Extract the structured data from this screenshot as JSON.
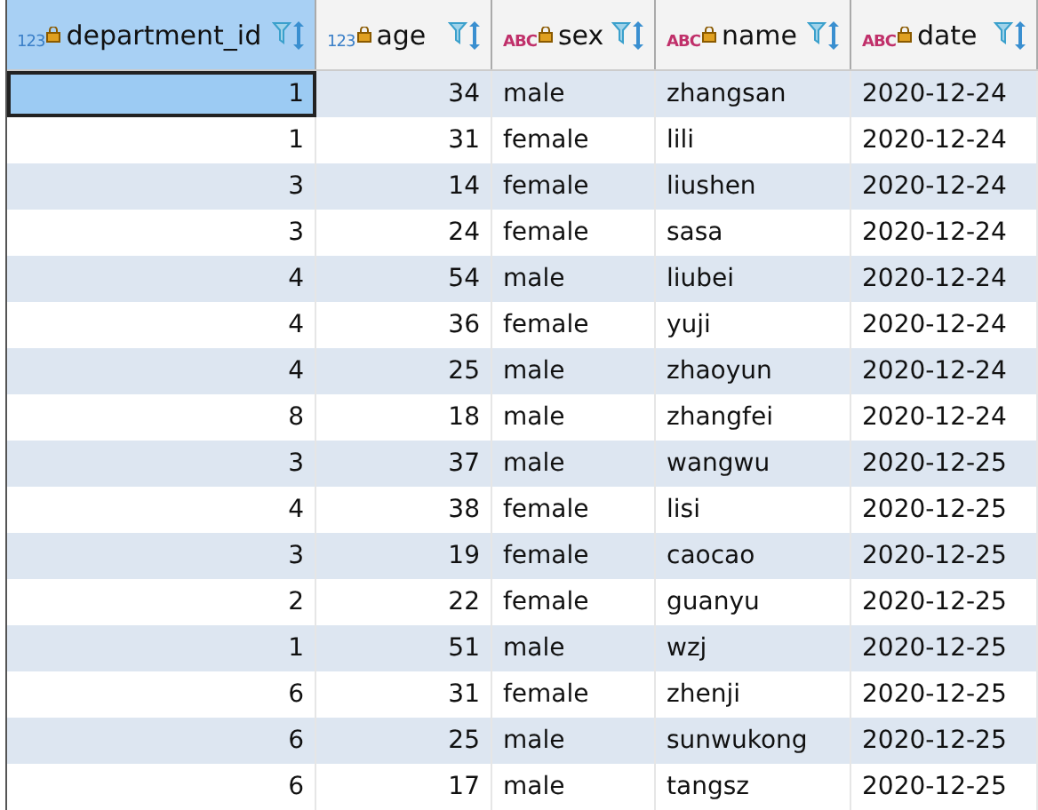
{
  "table": {
    "columns": [
      {
        "label": "department_id",
        "type_label": "123",
        "kind": "number",
        "selected": true
      },
      {
        "label": "age",
        "type_label": "123",
        "kind": "number",
        "selected": false
      },
      {
        "label": "sex",
        "type_label": "ABC",
        "kind": "text",
        "selected": false
      },
      {
        "label": "name",
        "type_label": "ABC",
        "kind": "text",
        "selected": false
      },
      {
        "label": "date",
        "type_label": "ABC",
        "kind": "text",
        "selected": false
      }
    ],
    "rows": [
      {
        "selected": true,
        "cells": [
          "1",
          "34",
          "male",
          "zhangsan",
          "2020-12-24"
        ]
      },
      {
        "selected": false,
        "cells": [
          "1",
          "31",
          "female",
          "lili",
          "2020-12-24"
        ]
      },
      {
        "selected": false,
        "cells": [
          "3",
          "14",
          "female",
          "liushen",
          "2020-12-24"
        ]
      },
      {
        "selected": false,
        "cells": [
          "3",
          "24",
          "female",
          "sasa",
          "2020-12-24"
        ]
      },
      {
        "selected": false,
        "cells": [
          "4",
          "54",
          "male",
          "liubei",
          "2020-12-24"
        ]
      },
      {
        "selected": false,
        "cells": [
          "4",
          "36",
          "female",
          "yuji",
          "2020-12-24"
        ]
      },
      {
        "selected": false,
        "cells": [
          "4",
          "25",
          "male",
          "zhaoyun",
          "2020-12-24"
        ]
      },
      {
        "selected": false,
        "cells": [
          "8",
          "18",
          "male",
          "zhangfei",
          "2020-12-24"
        ]
      },
      {
        "selected": false,
        "cells": [
          "3",
          "37",
          "male",
          "wangwu",
          "2020-12-25"
        ]
      },
      {
        "selected": false,
        "cells": [
          "4",
          "38",
          "female",
          "lisi",
          "2020-12-25"
        ]
      },
      {
        "selected": false,
        "cells": [
          "3",
          "19",
          "female",
          "caocao",
          "2020-12-25"
        ]
      },
      {
        "selected": false,
        "cells": [
          "2",
          "22",
          "female",
          "guanyu",
          "2020-12-25"
        ]
      },
      {
        "selected": false,
        "cells": [
          "1",
          "51",
          "male",
          "wzj",
          "2020-12-25"
        ]
      },
      {
        "selected": false,
        "cells": [
          "6",
          "31",
          "female",
          "zhenji",
          "2020-12-25"
        ]
      },
      {
        "selected": false,
        "cells": [
          "6",
          "25",
          "male",
          "sunwukong",
          "2020-12-25"
        ]
      },
      {
        "selected": false,
        "cells": [
          "6",
          "17",
          "male",
          "tangsz",
          "2020-12-25"
        ]
      }
    ]
  }
}
